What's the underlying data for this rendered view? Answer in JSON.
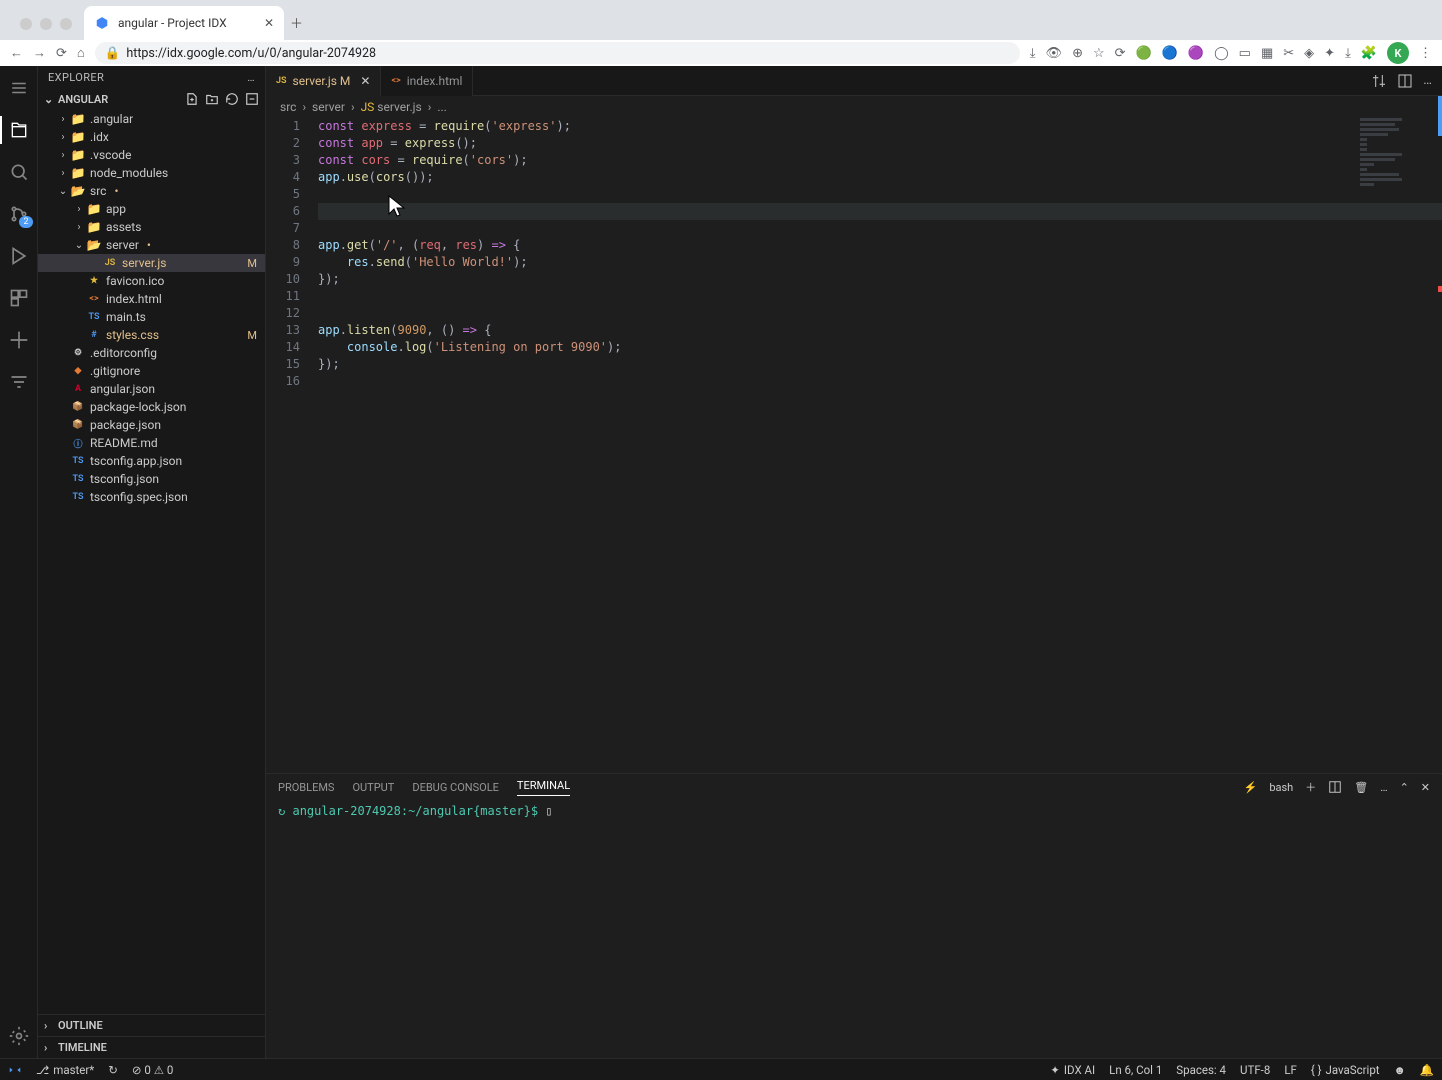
{
  "browser": {
    "tab_title": "angular - Project IDX",
    "url": "https://idx.google.com/u/0/angular-2074928",
    "avatar_initial": "K"
  },
  "explorer": {
    "title": "EXPLORER",
    "project_name": "ANGULAR",
    "tree": [
      {
        "depth": 1,
        "name": ".angular",
        "type": "folder",
        "open": false
      },
      {
        "depth": 1,
        "name": ".idx",
        "type": "folder",
        "open": false
      },
      {
        "depth": 1,
        "name": ".vscode",
        "type": "folder",
        "open": false
      },
      {
        "depth": 1,
        "name": "node_modules",
        "type": "folder",
        "open": false
      },
      {
        "depth": 1,
        "name": "src",
        "type": "folder",
        "open": true,
        "dot": true
      },
      {
        "depth": 2,
        "name": "app",
        "type": "folder",
        "open": false
      },
      {
        "depth": 2,
        "name": "assets",
        "type": "folder",
        "open": false
      },
      {
        "depth": 2,
        "name": "server",
        "type": "folder",
        "open": true,
        "dot": true
      },
      {
        "depth": 3,
        "name": "server.js",
        "type": "file",
        "icon": "js",
        "selected": true,
        "status": "M"
      },
      {
        "depth": 2,
        "name": "favicon.ico",
        "type": "file",
        "icon": "star"
      },
      {
        "depth": 2,
        "name": "index.html",
        "type": "file",
        "icon": "html"
      },
      {
        "depth": 2,
        "name": "main.ts",
        "type": "file",
        "icon": "ts"
      },
      {
        "depth": 2,
        "name": "styles.css",
        "type": "file",
        "icon": "css",
        "status": "M",
        "modified": true
      },
      {
        "depth": 1,
        "name": ".editorconfig",
        "type": "file",
        "icon": "cfg"
      },
      {
        "depth": 1,
        "name": ".gitignore",
        "type": "file",
        "icon": "git"
      },
      {
        "depth": 1,
        "name": "angular.json",
        "type": "file",
        "icon": "ng"
      },
      {
        "depth": 1,
        "name": "package-lock.json",
        "type": "file",
        "icon": "npm"
      },
      {
        "depth": 1,
        "name": "package.json",
        "type": "file",
        "icon": "npm"
      },
      {
        "depth": 1,
        "name": "README.md",
        "type": "file",
        "icon": "info"
      },
      {
        "depth": 1,
        "name": "tsconfig.app.json",
        "type": "file",
        "icon": "ts"
      },
      {
        "depth": 1,
        "name": "tsconfig.json",
        "type": "file",
        "icon": "ts"
      },
      {
        "depth": 1,
        "name": "tsconfig.spec.json",
        "type": "file",
        "icon": "ts"
      }
    ],
    "sections": {
      "outline": "OUTLINE",
      "timeline": "TIMELINE"
    }
  },
  "editor": {
    "tabs": [
      {
        "name": "server.js",
        "status": "M",
        "active": true,
        "icon": "js"
      },
      {
        "name": "index.html",
        "active": false,
        "icon": "html"
      }
    ],
    "breadcrumbs": [
      "src",
      "server",
      "server.js",
      "..."
    ],
    "lines": [
      {
        "n": 1,
        "html": "<span class='tok-kw'>const</span> <span class='tok-var'>express</span> <span class='tok-p'>=</span> <span class='tok-fn'>require</span><span class='tok-p'>(</span><span class='tok-str'>'express'</span><span class='tok-p'>);</span>"
      },
      {
        "n": 2,
        "html": "<span class='tok-kw'>const</span> <span class='tok-var'>app</span> <span class='tok-p'>=</span> <span class='tok-fn'>express</span><span class='tok-p'>();</span>"
      },
      {
        "n": 3,
        "html": "<span class='tok-kw'>const</span> <span class='tok-var'>cors</span> <span class='tok-p'>=</span> <span class='tok-fn'>require</span><span class='tok-p'>(</span><span class='tok-str'>'cors'</span><span class='tok-p'>);</span>"
      },
      {
        "n": 4,
        "html": "<span class='tok-obj'>app</span><span class='tok-p'>.</span><span class='tok-fn'>use</span><span class='tok-p'>(</span><span class='tok-fn'>cors</span><span class='tok-p'>());</span>"
      },
      {
        "n": 5,
        "html": ""
      },
      {
        "n": 6,
        "html": "",
        "highlight": true
      },
      {
        "n": 7,
        "html": ""
      },
      {
        "n": 8,
        "html": "<span class='tok-obj'>app</span><span class='tok-p'>.</span><span class='tok-fn'>get</span><span class='tok-p'>(</span><span class='tok-str'>'/'</span><span class='tok-p'>, (</span><span class='tok-var'>req</span><span class='tok-p'>, </span><span class='tok-var'>res</span><span class='tok-p'>) </span><span class='tok-kw'>=&gt;</span><span class='tok-p'> {</span>"
      },
      {
        "n": 9,
        "html": "    <span class='tok-obj'>res</span><span class='tok-p'>.</span><span class='tok-fn'>send</span><span class='tok-p'>(</span><span class='tok-str'>'Hello World!'</span><span class='tok-p'>);</span>"
      },
      {
        "n": 10,
        "html": "<span class='tok-p'>});</span>"
      },
      {
        "n": 11,
        "html": ""
      },
      {
        "n": 12,
        "html": ""
      },
      {
        "n": 13,
        "html": "<span class='tok-obj'>app</span><span class='tok-p'>.</span><span class='tok-fn'>listen</span><span class='tok-p'>(</span><span class='tok-num'>9090</span><span class='tok-p'>, () </span><span class='tok-kw'>=&gt;</span><span class='tok-p'> {</span>"
      },
      {
        "n": 14,
        "html": "    <span class='tok-obj'>console</span><span class='tok-p'>.</span><span class='tok-fn'>log</span><span class='tok-p'>(</span><span class='tok-str'>'Listening on port 9090'</span><span class='tok-p'>);</span>"
      },
      {
        "n": 15,
        "html": "<span class='tok-p'>});</span>"
      },
      {
        "n": 16,
        "html": ""
      }
    ]
  },
  "panel": {
    "tabs": [
      "PROBLEMS",
      "OUTPUT",
      "DEBUG CONSOLE",
      "TERMINAL"
    ],
    "active_tab": "TERMINAL",
    "shell_label": "bash",
    "prompt": "angular-2074928:~/angular{master}$"
  },
  "status": {
    "branch": "master*",
    "problems": "⊘ 0  ⚠ 0",
    "idx_ai": "IDX AI",
    "position": "Ln 6, Col 1",
    "spaces": "Spaces: 4",
    "encoding": "UTF-8",
    "eol": "LF",
    "language": "JavaScript"
  },
  "activity_badge": "2"
}
